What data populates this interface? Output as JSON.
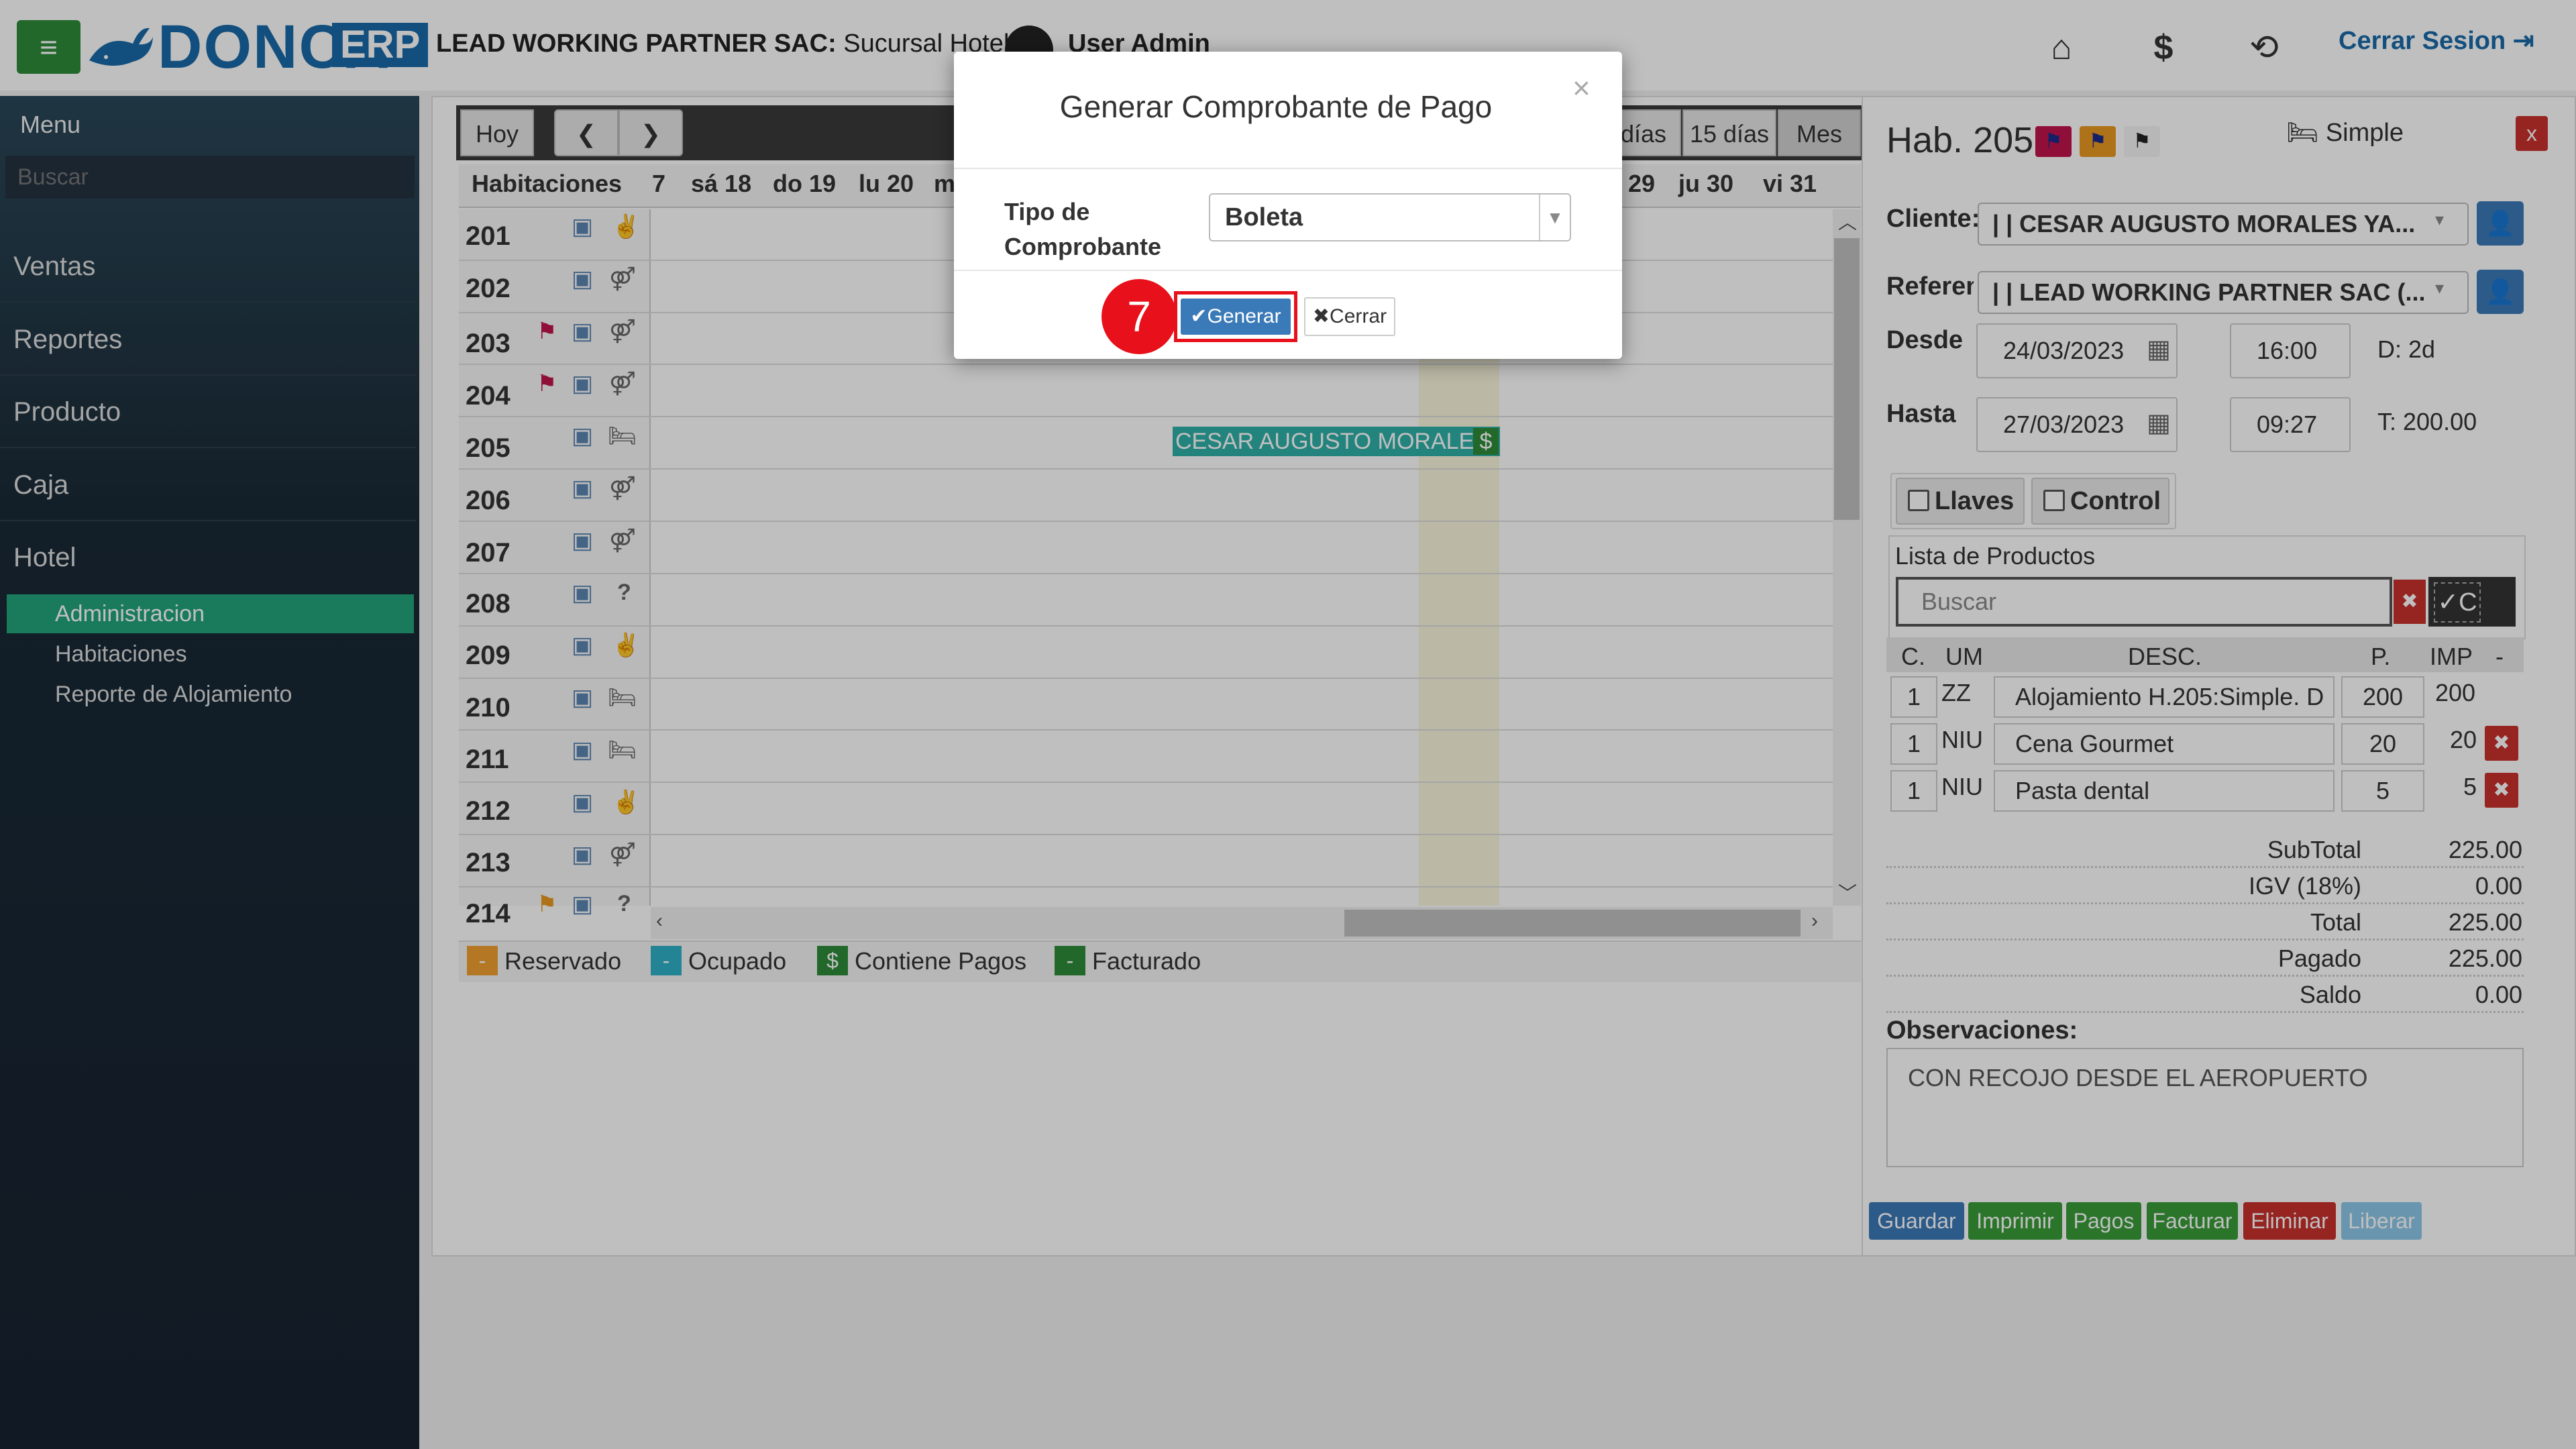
{
  "header": {
    "logo_main": "DONCA",
    "logo_badge": "ERP",
    "company_bold": "LEAD WORKING PARTNER SAC:",
    "company_rest": " Sucursal Hotel -- |",
    "user": "User Admin",
    "logout": "Cerrar Sesion"
  },
  "sidebar": {
    "title": "Menu",
    "search_placeholder": "Buscar",
    "items": [
      "Ventas",
      "Reportes",
      "Producto",
      "Caja",
      "Hotel"
    ],
    "sub_items": [
      "Administracion",
      "Habitaciones",
      "Reporte de Alojamiento"
    ]
  },
  "calendar": {
    "btn_today": "Hoy",
    "btn_prev": "❮",
    "btn_next": "❯",
    "view_days": "días",
    "view_15": "15 días",
    "view_month": "Mes",
    "rooms_header": "Habitaciones",
    "days": [
      "7",
      "sá 18",
      "do 19",
      "lu 20",
      "m",
      "29",
      "ju 30",
      "vi 31"
    ],
    "rooms": [
      "201",
      "202",
      "203",
      "204",
      "205",
      "206",
      "207",
      "208",
      "209",
      "210",
      "211",
      "212",
      "213",
      "214"
    ],
    "booking_name": "CESAR AUGUSTO MORALES",
    "booking_icon": "$",
    "legend": [
      {
        "label": "Reservado",
        "color": "#f0a030",
        "mark": "-"
      },
      {
        "label": "Ocupado",
        "color": "#2fb0c8",
        "mark": "-"
      },
      {
        "label": "Contiene Pagos",
        "color": "#2e8b3a",
        "mark": "$"
      },
      {
        "label": "Facturado",
        "color": "#2e8b3a",
        "mark": "-"
      }
    ]
  },
  "room_panel": {
    "title": "Hab. 205",
    "type": "Simple",
    "close": "x",
    "cliente_label": "Cliente:",
    "cliente_value": "| | CESAR AUGUSTO MORALES YA...",
    "referencia_label": "Referen",
    "referencia_value": "| | LEAD WORKING PARTNER SAC (...",
    "desde_label": "Desde",
    "desde_date": "24/03/2023",
    "desde_time": "16:00",
    "duration": "D: 2d",
    "hasta_label": "Hasta",
    "hasta_date": "27/03/2023",
    "hasta_time": "09:27",
    "total_short": "T: 200.00",
    "llaves": "Llaves",
    "control": "Control",
    "products_title": "Lista de Productos",
    "products_search": "Buscar",
    "products_c": "✓C",
    "cols": {
      "c": "C.",
      "um": "UM",
      "desc": "DESC.",
      "p": "P.",
      "imp": "IMP",
      "minus": "-"
    },
    "products": [
      {
        "c": "1",
        "um": "ZZ",
        "desc": "Alojamiento H.205:Simple. D",
        "p": "200",
        "imp": "200"
      },
      {
        "c": "1",
        "um": "NIU",
        "desc": "Cena Gourmet",
        "p": "20",
        "imp": "20"
      },
      {
        "c": "1",
        "um": "NIU",
        "desc": "Pasta dental",
        "p": "5",
        "imp": "5"
      }
    ],
    "totals": [
      {
        "label": "SubTotal",
        "value": "225.00"
      },
      {
        "label": "IGV (18%)",
        "value": "0.00"
      },
      {
        "label": "Total",
        "value": "225.00"
      },
      {
        "label": "Pagado",
        "value": "225.00"
      },
      {
        "label": "Saldo",
        "value": "0.00"
      }
    ],
    "obs_label": "Observaciones:",
    "obs_value": "CON RECOJO DESDE EL AEROPUERTO",
    "actions": [
      "Guardar",
      "Imprimir",
      "Pagos",
      "Facturar",
      "Eliminar",
      "Liberar"
    ]
  },
  "modal": {
    "title": "Generar Comprobante de Pago",
    "close": "×",
    "tipo_label": "Tipo de Comprobante",
    "tipo_value": "Boleta",
    "step": "7",
    "generar": "✔Generar",
    "cerrar": "✖Cerrar"
  },
  "colors": {
    "brand_blue": "#1a6aa8",
    "menu_green": "#2e8b3a",
    "active_teal": "#22a57a",
    "danger": "#c9302c",
    "highlight": "#e8101a"
  }
}
